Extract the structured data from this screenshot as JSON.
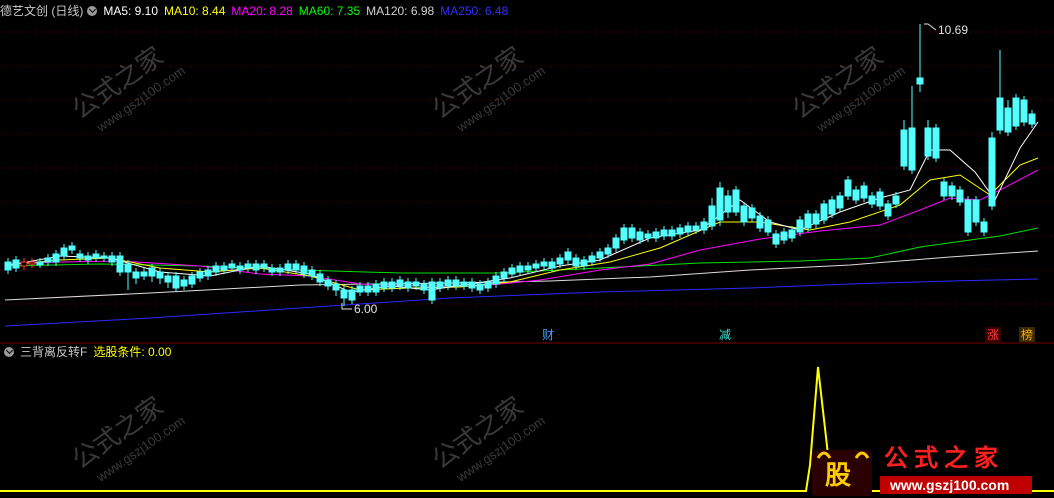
{
  "main_header": {
    "title": "德艺文创 (日线)",
    "indicators": [
      {
        "label": "MA5: 9.10",
        "color": "#ffffff"
      },
      {
        "label": "MA10: 8.44",
        "color": "#ffff00"
      },
      {
        "label": "MA20: 8.28",
        "color": "#ff00ff"
      },
      {
        "label": "MA60: 7.35",
        "color": "#00ff00"
      },
      {
        "label": "MA120: 6.98",
        "color": "#d0d0d0"
      },
      {
        "label": "MA250: 6.48",
        "color": "#3030ff"
      }
    ]
  },
  "sub_header": {
    "title": "三背离反转F",
    "condition_label": "选股条件: 0.00",
    "condition_color": "#ffff00"
  },
  "annotations": {
    "high_label": "10.69",
    "low_label": "6.00"
  },
  "event_markers": [
    {
      "text": "财",
      "color": "#40a0ff"
    },
    {
      "text": "减",
      "color": "#40e0d0"
    },
    {
      "text": "涨",
      "color": "#ff4040"
    },
    {
      "text": "榜",
      "color": "#ffaa00"
    }
  ],
  "watermark": {
    "brand": "公式之家",
    "url": "www.gszj100.com"
  },
  "colors": {
    "up": "#ff3b3b",
    "down": "#54ffff",
    "background": "#000000",
    "divider": "#7a0000",
    "indicator_line": "#ffff00"
  }
}
